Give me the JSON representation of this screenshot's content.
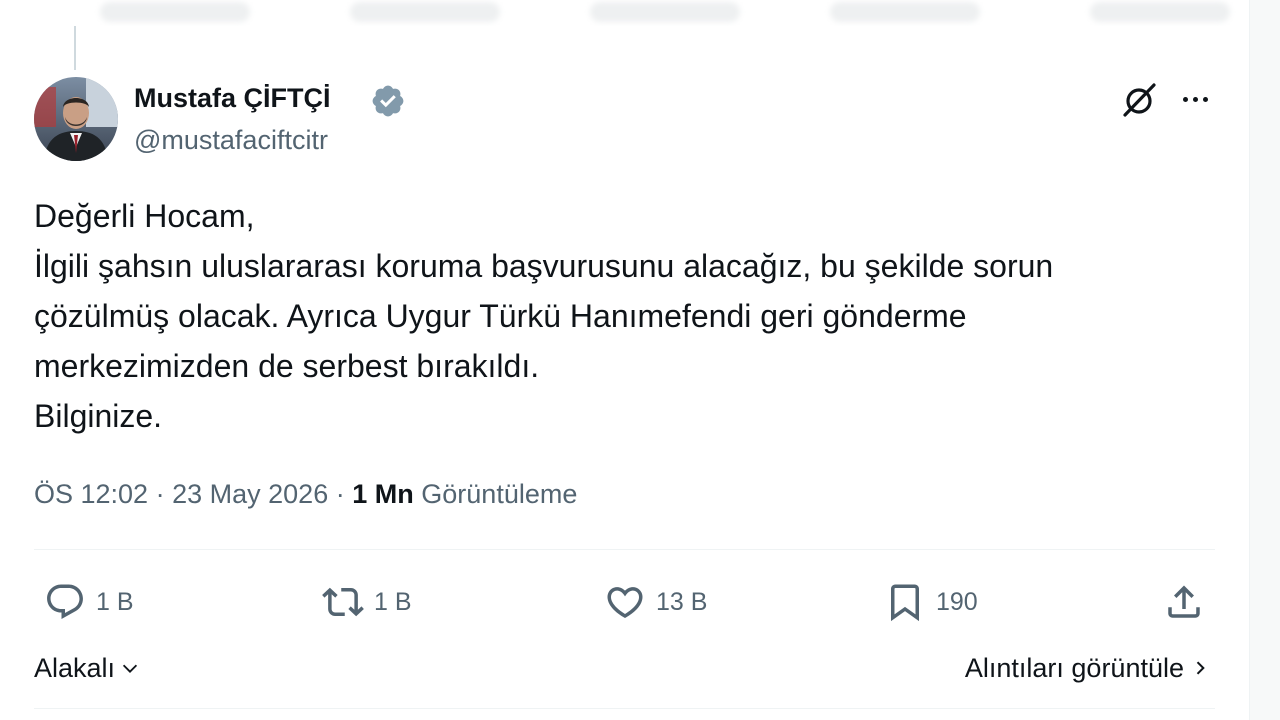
{
  "tweet": {
    "author": {
      "name": "Mustafa ÇİFTÇİ",
      "handle": "@mustafaciftcitr",
      "verified": true
    },
    "text_lines": [
      "Değerli Hocam,",
      "İlgili şahsın uluslararası koruma başvurusunu alacağız, bu şekilde sorun",
      "çözülmüş olacak. Ayrıca Uygur Türkü Hanımefendi geri gönderme",
      "merkezimizden de serbest bırakıldı.",
      "Bilginize."
    ],
    "meta": {
      "time": "ÖS 12:02",
      "separator": "·",
      "date": "23 May 2026",
      "views_count": "1 Mn",
      "views_label": "Görüntüleme"
    },
    "actions": {
      "replies": "1 B",
      "reposts": "1 B",
      "likes": "13 B",
      "bookmarks": "190"
    },
    "footer": {
      "related_label": "Alakalı",
      "quotes_label": "Alıntıları görüntüle"
    }
  },
  "icons": {
    "verified": "verified-badge-icon",
    "grok": "grok-icon",
    "more": "more-icon",
    "reply": "reply-icon",
    "repost": "repost-icon",
    "like": "heart-icon",
    "bookmark": "bookmark-icon",
    "share": "share-icon"
  },
  "colors": {
    "text": "#0f1419",
    "secondary": "#536471",
    "divider": "#eff3f4",
    "verified_badge": "#829aab"
  }
}
